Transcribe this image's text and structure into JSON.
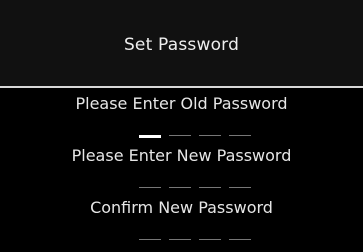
{
  "screen": {
    "title": "Set Password"
  },
  "fields": [
    {
      "label": "Please Enter Old Password",
      "digits": 4,
      "active_index": 0
    },
    {
      "label": "Please Enter New Password",
      "digits": 4,
      "active_index": -1
    },
    {
      "label": "Confirm New Password",
      "digits": 4,
      "active_index": -1
    }
  ],
  "colors": {
    "background": "#000000",
    "header": "#111111",
    "text": "#e6e6e6",
    "active_slot": "#ffffff",
    "inactive_slot": "#777777"
  }
}
